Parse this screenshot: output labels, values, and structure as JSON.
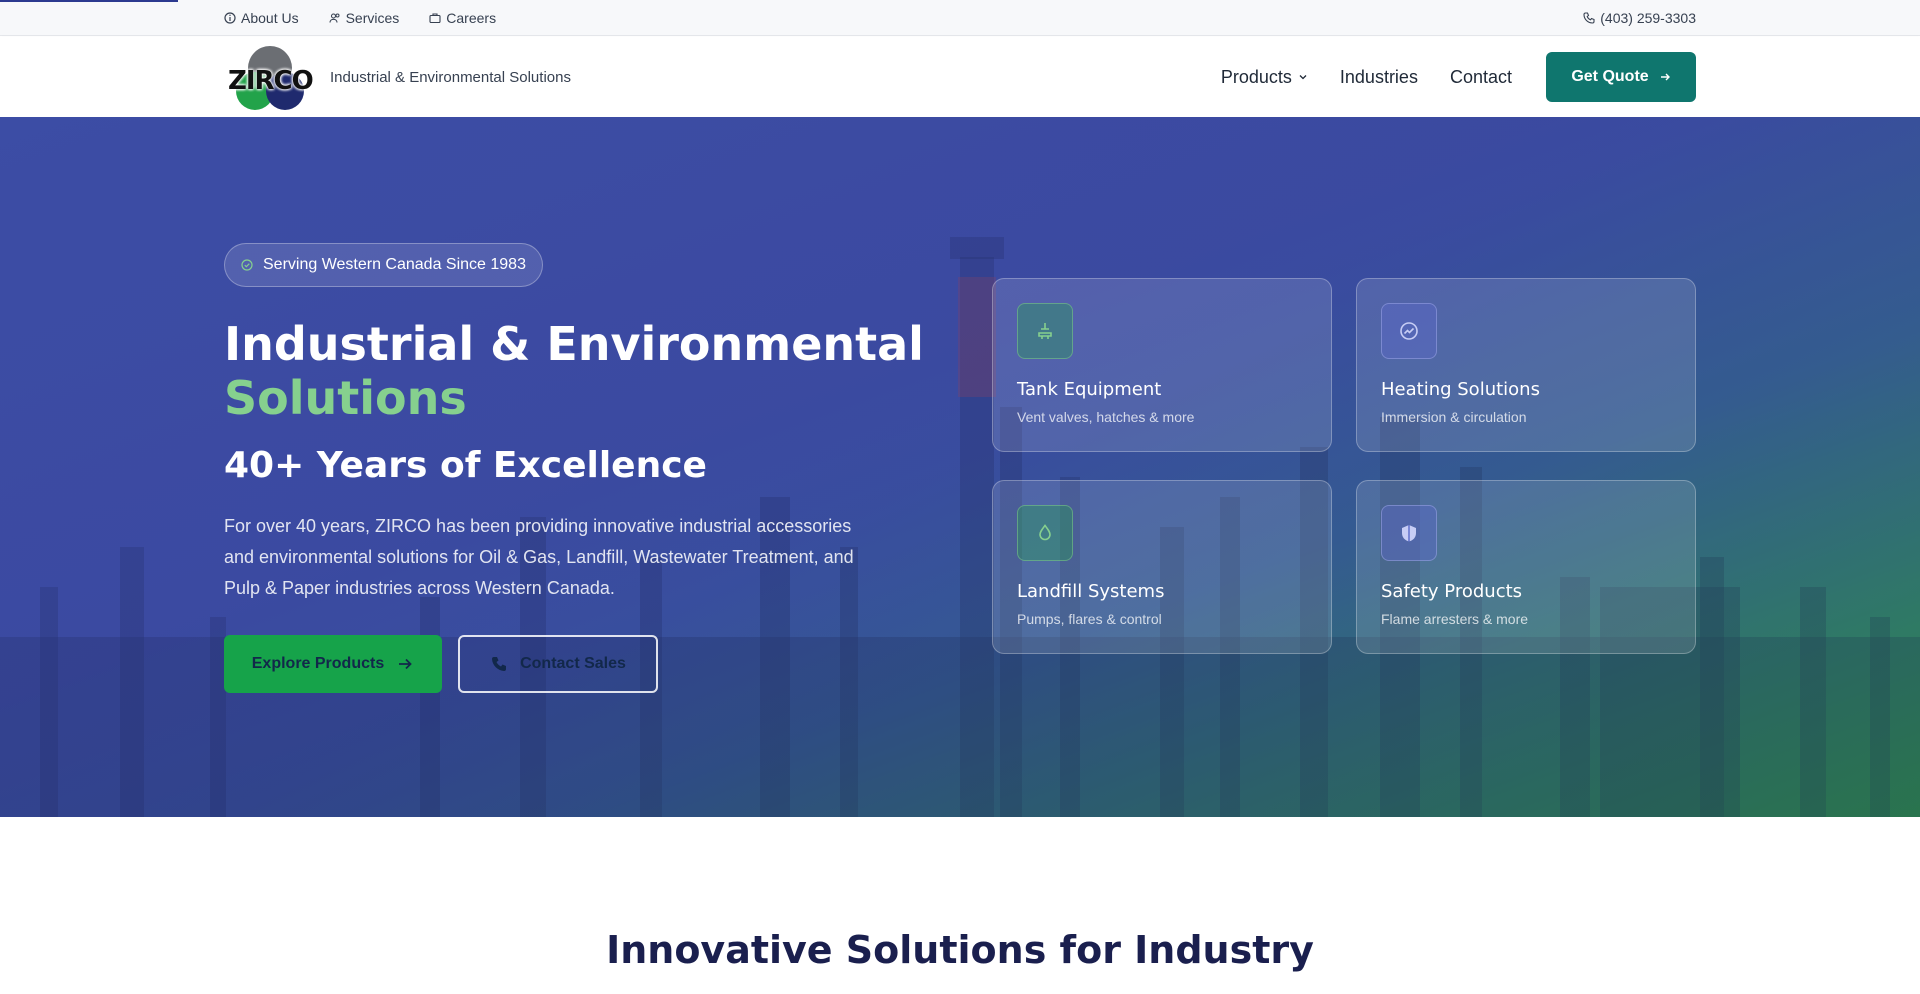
{
  "topbar": {
    "links": [
      {
        "label": "About Us",
        "icon": "info-icon"
      },
      {
        "label": "Services",
        "icon": "users-icon"
      },
      {
        "label": "Careers",
        "icon": "briefcase-icon"
      }
    ],
    "phone": "(403) 259-3303"
  },
  "nav": {
    "logo_text": "ZIRCO",
    "tagline": "Industrial & Environmental Solutions",
    "items": [
      {
        "label": "Products",
        "has_dropdown": true
      },
      {
        "label": "Industries",
        "has_dropdown": false
      },
      {
        "label": "Contact",
        "has_dropdown": false
      }
    ],
    "cta_label": "Get Quote"
  },
  "hero": {
    "badge": "Serving Western Canada Since 1983",
    "title_line1": "Industrial & Environmental",
    "title_accent": "Solutions",
    "subtitle": "40+ Years of Excellence",
    "description": "For over 40 years, ZIRCO has been providing innovative industrial accessories and environmental solutions for Oil & Gas, Landfill, Wastewater Treatment, and Pulp & Paper industries across Western Canada.",
    "primary_button": "Explore Products",
    "secondary_button": "Contact Sales",
    "cards": [
      {
        "title": "Tank Equipment",
        "subtitle": "Vent valves, hatches & more",
        "icon": "valve-icon"
      },
      {
        "title": "Heating Solutions",
        "subtitle": "Immersion & circulation",
        "icon": "gauge-icon"
      },
      {
        "title": "Landfill Systems",
        "subtitle": "Pumps, flares & control",
        "icon": "droplet-icon"
      },
      {
        "title": "Safety Products",
        "subtitle": "Flame arresters & more",
        "icon": "shield-icon"
      }
    ]
  },
  "section": {
    "title": "Innovative Solutions for Industry"
  },
  "colors": {
    "brand_teal": "#0f766e",
    "brand_green": "#16a34a",
    "accent_green": "#86d08e",
    "navy": "#1a1f4e"
  }
}
